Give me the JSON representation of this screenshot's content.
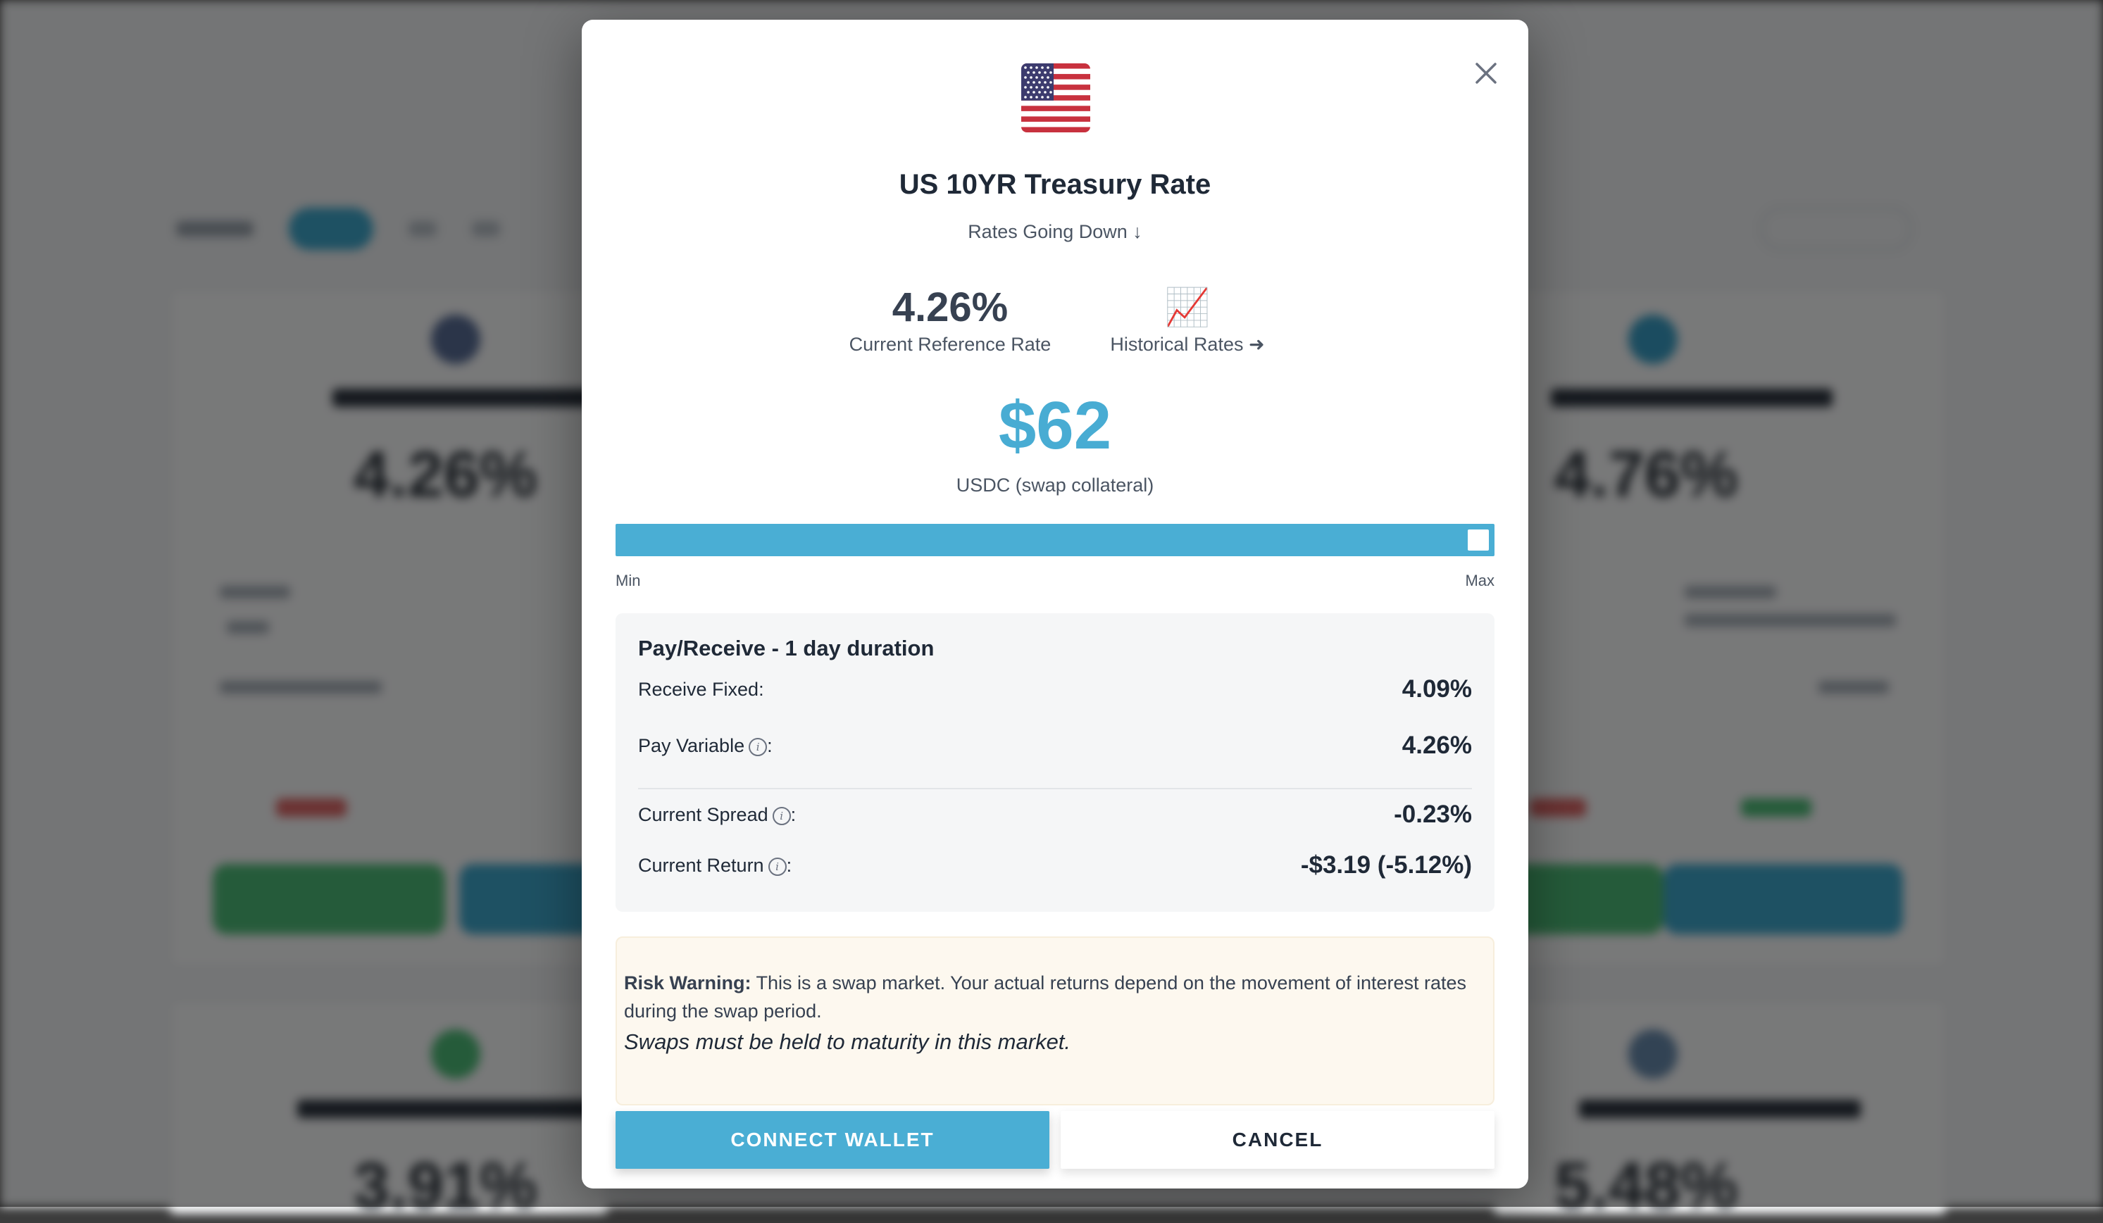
{
  "modal": {
    "title": "US 10YR Treasury Rate",
    "subtitle": "Rates Going Down ↓",
    "close_icon": "close-icon",
    "flag_icon": "us-flag-icon"
  },
  "stats": {
    "reference_rate_value": "4.26%",
    "reference_rate_label": "Current Reference Rate",
    "historical_icon": "📈",
    "historical_label": "Historical Rates ➜"
  },
  "collateral": {
    "amount": "$62",
    "label": "USDC (swap collateral)",
    "slider_level": 1.0,
    "slider_min_label": "Min",
    "slider_max_label": "Max"
  },
  "summary": {
    "title": "Pay/Receive - 1 day duration",
    "receive_fixed_label": "Receive Fixed:",
    "receive_fixed_value": "4.09%",
    "pay_variable_label": "Pay Variable",
    "pay_variable_value": "4.26%",
    "current_spread_label": "Current Spread",
    "current_spread_value": "-0.23%",
    "current_return_label": "Current Return",
    "current_return_value": "-$3.19 (-5.12%)",
    "info_glyph": "i",
    "colon": ":"
  },
  "risk": {
    "heading": "Risk Warning:",
    "text": " This is a swap market. Your actual returns depend on the movement of interest rates during the swap period.",
    "maturity_note": "Swaps must be held to maturity in this market."
  },
  "actions": {
    "connect_label": "CONNECT WALLET",
    "cancel_label": "CANCEL"
  },
  "colors": {
    "accent": "#4aaed4",
    "overlay": "rgba(0,0,0,0.52)",
    "warning_bg": "#fdf8ef"
  }
}
